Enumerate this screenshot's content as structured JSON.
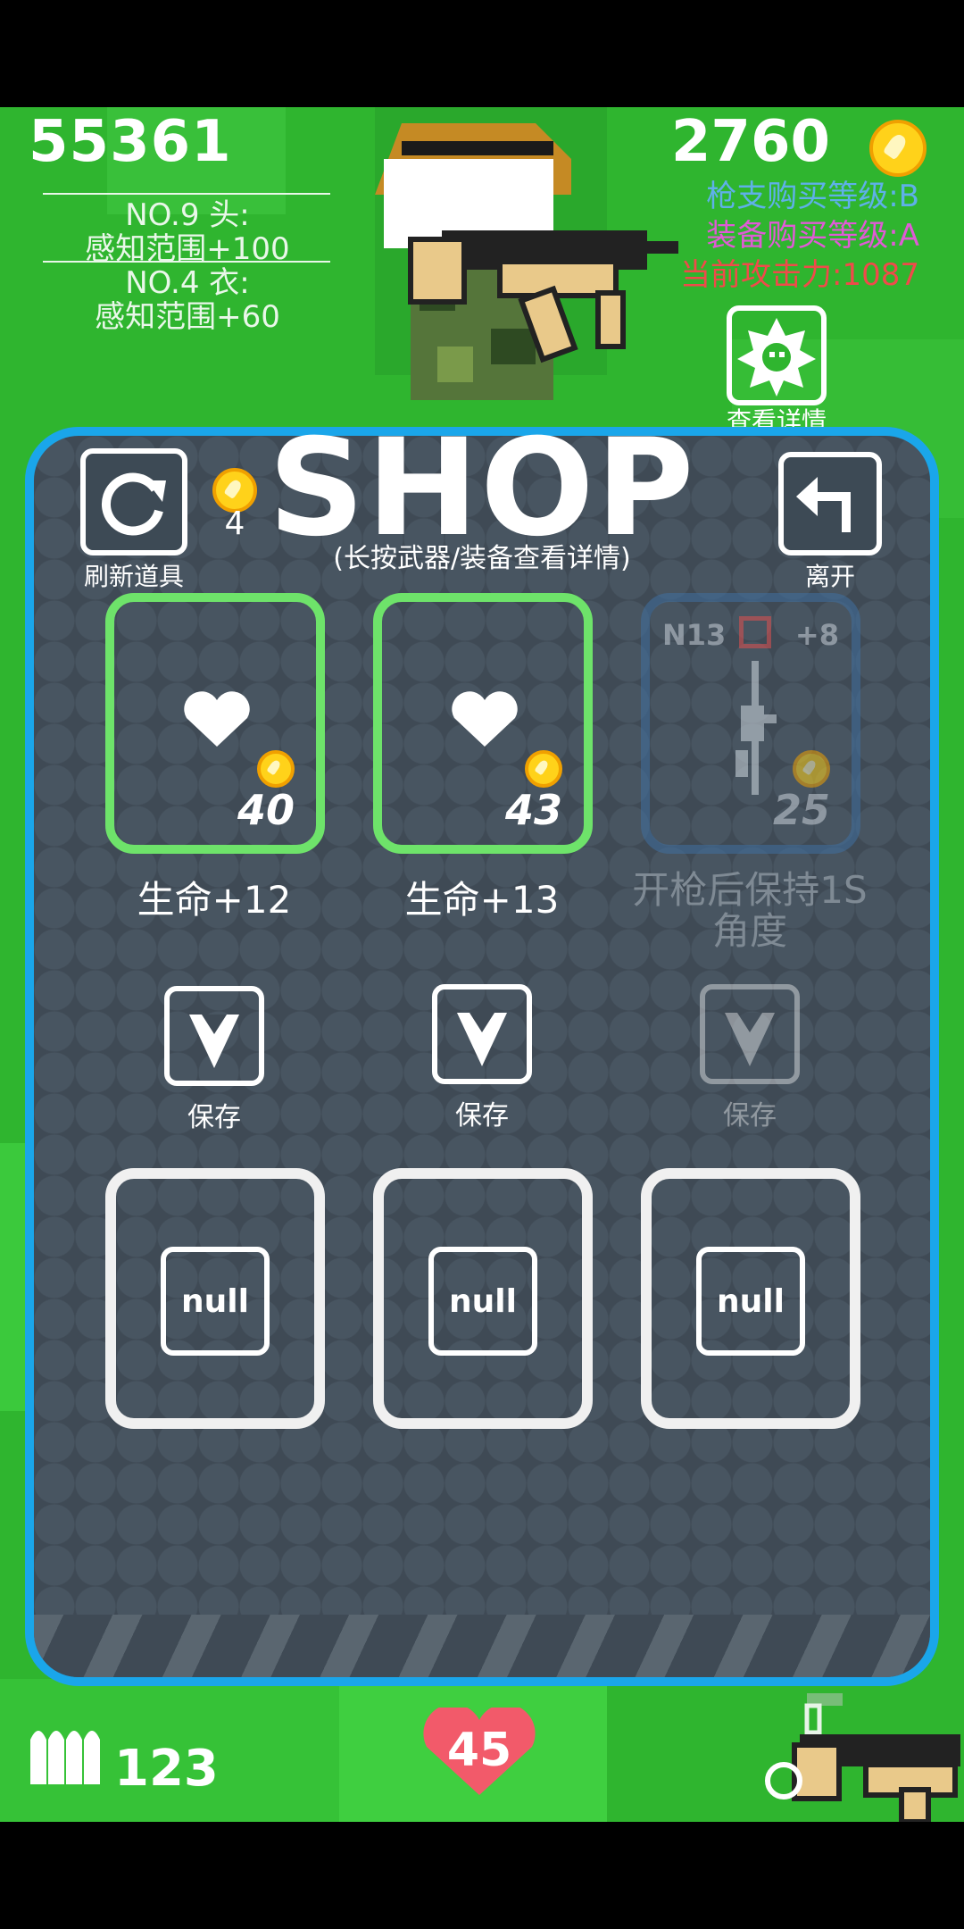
{
  "hud": {
    "score": "55361",
    "equip": [
      {
        "line1": "NO.9 头:",
        "line2": "感知范围+100"
      },
      {
        "line1": "NO.4 衣:",
        "line2": "感知范围+60"
      }
    ],
    "coins": "2760",
    "gun_level": "枪支购买等级:B",
    "equip_level": "装备购买等级:A",
    "attack": "当前攻击力:1087",
    "details_label": "查看详情",
    "ammo": "123",
    "health": "45"
  },
  "shop": {
    "title": "SHOP",
    "subtitle": "(长按武器/装备查看详情)",
    "refresh_label": "刷新道具",
    "refresh_cost": "4",
    "exit_label": "离开",
    "items": [
      {
        "icon": "heart-icon",
        "price": "40",
        "name": "生命+12",
        "available": true
      },
      {
        "icon": "heart-icon",
        "price": "43",
        "name": "生命+13",
        "available": true
      },
      {
        "icon": "rifle-icon",
        "price": "25",
        "name": "开枪后保持1S角度",
        "code": "N13",
        "bonus": "+8",
        "available": false
      }
    ],
    "save_label": "保存",
    "slots": [
      "null",
      "null",
      "null"
    ]
  },
  "colors": {
    "grass": "#2fb52f",
    "panel": "#3f4a55",
    "panel_border": "#1aa6ea",
    "card_border": "#6ee36a",
    "gun_level": "#5fb0e8",
    "equip_level": "#e05ad6",
    "attack": "#f04a4a",
    "coin": "#ffd21a",
    "heart_red": "#f25a6a"
  }
}
